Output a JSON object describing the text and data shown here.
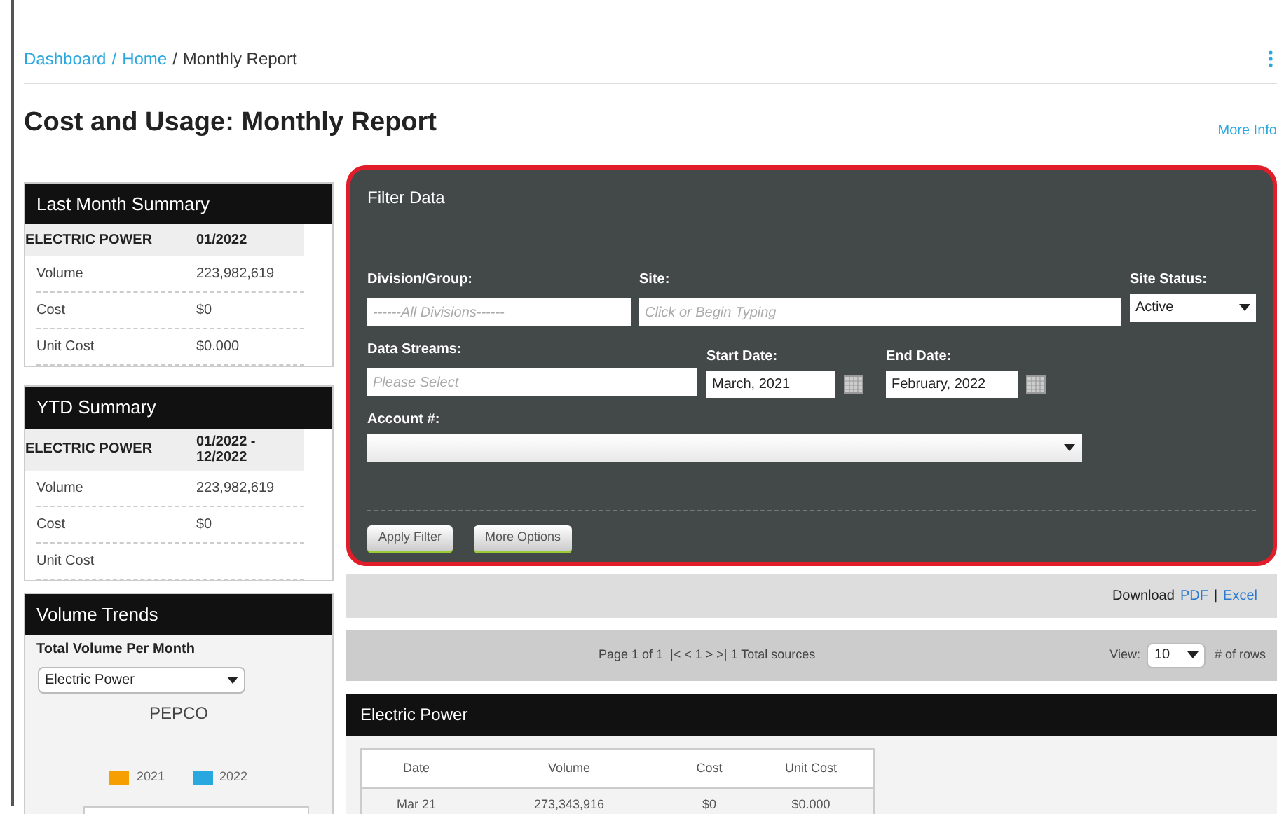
{
  "breadcrumb": {
    "links": [
      "Dashboard",
      "Home"
    ],
    "current": "Monthly Report",
    "separator": "/"
  },
  "title": "Cost and Usage: Monthly Report",
  "more_info": "More Info",
  "last_month_summary": {
    "title": "Last Month Summary",
    "header": [
      "ELECTRIC POWER",
      "01/2022"
    ],
    "rows": [
      {
        "label": "Volume",
        "value": "223,982,619"
      },
      {
        "label": "Cost",
        "value": "$0"
      },
      {
        "label": "Unit Cost",
        "value": "$0.000"
      }
    ]
  },
  "ytd_summary": {
    "title": "YTD Summary",
    "header": [
      "ELECTRIC POWER",
      "01/2022 - 12/2022"
    ],
    "rows": [
      {
        "label": "Volume",
        "value": "223,982,619"
      },
      {
        "label": "Cost",
        "value": "$0"
      },
      {
        "label": "Unit Cost"
      }
    ]
  },
  "volume_trends": {
    "title": "Volume Trends",
    "subtitle": "Total Volume Per Month",
    "select": "Electric Power",
    "chart_title": "PEPCO",
    "legend": [
      {
        "label": "2021",
        "color": "#f5a000"
      },
      {
        "label": "2022",
        "color": "#29a8e0"
      }
    ]
  },
  "filter": {
    "title": "Filter Data",
    "division": {
      "label": "Division/Group:",
      "placeholder": "------All Divisions------"
    },
    "site": {
      "label": "Site:",
      "placeholder": "Click or Begin Typing"
    },
    "site_status": {
      "label": "Site Status:",
      "value": "Active"
    },
    "data_streams": {
      "label": "Data Streams:",
      "placeholder": "Please Select"
    },
    "start_date": {
      "label": "Start Date:",
      "value": "March, 2021"
    },
    "end_date": {
      "label": "End Date:",
      "value": "February, 2022"
    },
    "account": {
      "label": "Account #:"
    },
    "buttons": [
      "Apply Filter",
      "More Options"
    ]
  },
  "download": {
    "label": "Download",
    "links": [
      "PDF",
      "Excel"
    ],
    "separator": "|"
  },
  "pager": {
    "text": "Page 1 of 1  |< < 1 > >| 1 Total sources",
    "view_label": "View:",
    "view_value": "10",
    "rows_label": "# of rows"
  },
  "table": {
    "title": "Electric Power",
    "columns": [
      "Date",
      "Volume",
      "Cost",
      "Unit Cost"
    ],
    "rows": [
      [
        "Mar 21",
        "273,343,916",
        "$0",
        "$0.000"
      ]
    ]
  }
}
